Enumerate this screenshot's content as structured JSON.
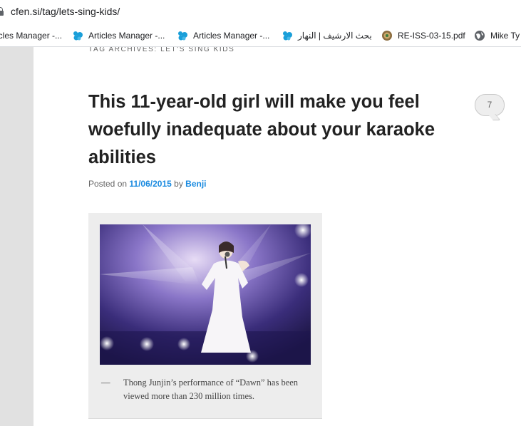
{
  "browser": {
    "url": "cfen.si/tag/lets-sing-kids/",
    "bookmarks": [
      {
        "label": "icles Manager -...",
        "icon": "tab-icon"
      },
      {
        "label": "Articles Manager -...",
        "icon": "cloud-bird-icon"
      },
      {
        "label": "Articles Manager -...",
        "icon": "cloud-bird-icon"
      },
      {
        "label": "بحث الارشيف | النهار",
        "icon": "cloud-bird-icon"
      },
      {
        "label": "RE-ISS-03-15.pdf",
        "icon": "seal-icon"
      },
      {
        "label": "Mike Ty",
        "icon": "globe-icon"
      }
    ]
  },
  "page": {
    "tag_archives": "TAG ARCHIVES: LET'S SING KIDS",
    "post": {
      "title": "This 11-year-old girl will make you feel woefully inadequate about your karaoke abilities",
      "comments_count": "7",
      "posted_on_label": "Posted on",
      "date": "11/06/2015",
      "by_label": "by",
      "author": "Benji",
      "image_caption_dash": "—",
      "image_caption": "Thong Junjin’s performance of “Dawn” has been viewed more than 230 million times."
    }
  },
  "colors": {
    "link": "#1b8be0",
    "title": "#222222",
    "sidebar_strip": "#e1e1e1",
    "caption_bg": "#ededed",
    "bookmark_icon": "#1a9fd9"
  }
}
